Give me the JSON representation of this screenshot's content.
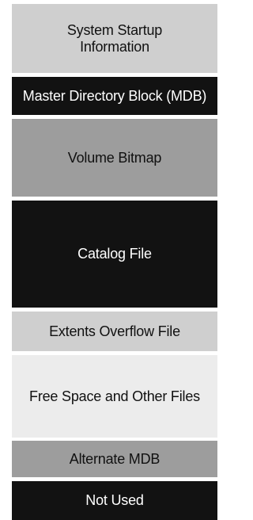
{
  "diagram": {
    "blocks": [
      {
        "label": "System Startup\nInformation",
        "fill": "#cfcfcf",
        "text_color": "#111111"
      },
      {
        "label": "Master Directory Block (MDB)",
        "fill": "#121212",
        "text_color": "#ffffff"
      },
      {
        "label": "Volume Bitmap",
        "fill": "#9d9d9d",
        "text_color": "#111111"
      },
      {
        "label": "Catalog File",
        "fill": "#121212",
        "text_color": "#ffffff"
      },
      {
        "label": "Extents Overflow File",
        "fill": "#cfcfcf",
        "text_color": "#111111"
      },
      {
        "label": "Free Space and Other Files",
        "fill": "#ececec",
        "text_color": "#111111"
      },
      {
        "label": "Alternate MDB",
        "fill": "#9d9d9d",
        "text_color": "#111111"
      },
      {
        "label": "Not Used",
        "fill": "#121212",
        "text_color": "#ffffff"
      }
    ]
  }
}
